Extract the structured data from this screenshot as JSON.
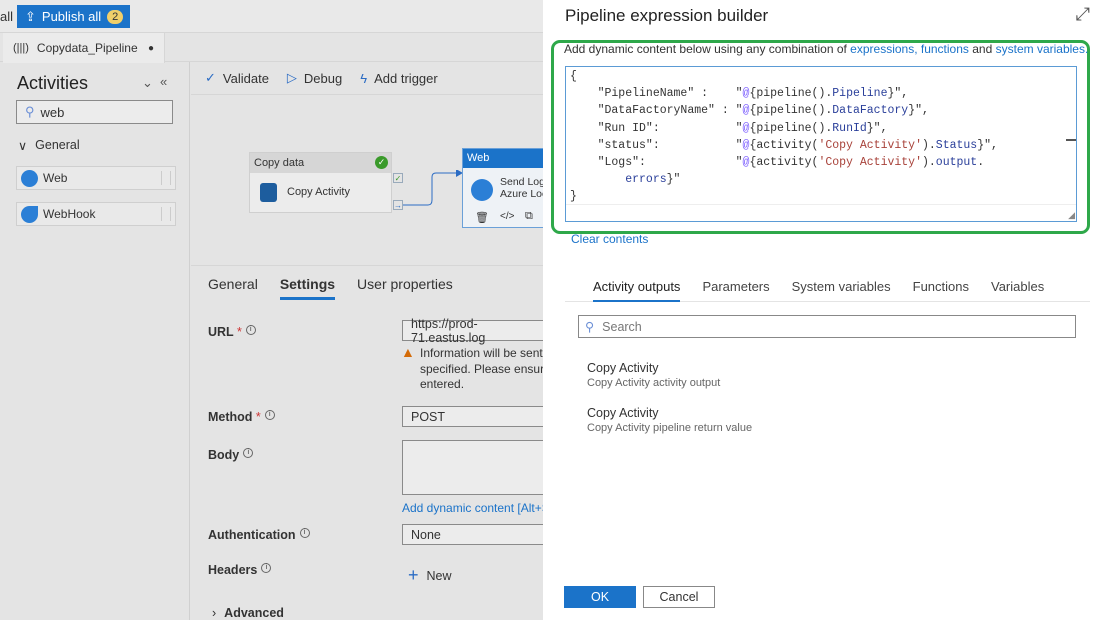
{
  "topbar": {
    "partial_label": "all",
    "publish_label": "Publish all",
    "publish_count": "2"
  },
  "pipeline_tab": {
    "name": "Copydata_Pipeline",
    "unsaved_dot": "●"
  },
  "activities": {
    "title": "Activities",
    "search_value": "web",
    "group": "General",
    "items": [
      {
        "label": "Web"
      },
      {
        "label": "WebHook"
      }
    ]
  },
  "toolbar": {
    "validate": "Validate",
    "debug": "Debug",
    "add_trigger": "Add trigger"
  },
  "canvas": {
    "copy_node": {
      "header": "Copy data",
      "name": "Copy Activity"
    },
    "web_node": {
      "header": "Web",
      "name_line1": "Send Log",
      "name_line2": "Azure Loc"
    }
  },
  "settings": {
    "tabs": [
      "General",
      "Settings",
      "User properties"
    ],
    "url_label": "URL",
    "url_value": "https://prod-71.eastus.log",
    "warning": [
      "Information will be sent",
      "specified. Please ensure",
      "entered."
    ],
    "method_label": "Method",
    "method_value": "POST",
    "body_label": "Body",
    "dynamic_link": "Add dynamic content [Alt+Sh",
    "auth_label": "Authentication",
    "auth_value": "None",
    "headers_label": "Headers",
    "new_label": "New",
    "advanced_label": "Advanced",
    "required": "*"
  },
  "builder": {
    "title": "Pipeline expression builder",
    "desc_prefix": "Add dynamic content below using any combination of ",
    "desc_link1": "expressions, functions",
    "desc_mid": " and ",
    "desc_link2": "system variables.",
    "code_lines": [
      [
        [
          "p",
          "{"
        ]
      ],
      [
        [
          "p",
          "    \"PipelineName\" :    \""
        ],
        [
          "at",
          "@"
        ],
        [
          "p",
          "{pipeline()."
        ],
        [
          "prop",
          "Pipeline"
        ],
        [
          "p",
          "}\","
        ]
      ],
      [
        [
          "p",
          "    \"DataFactoryName\" : \""
        ],
        [
          "at",
          "@"
        ],
        [
          "p",
          "{pipeline()."
        ],
        [
          "prop",
          "DataFactory"
        ],
        [
          "p",
          "}\","
        ]
      ],
      [
        [
          "p",
          "    \"Run ID\":           \""
        ],
        [
          "at",
          "@"
        ],
        [
          "p",
          "{pipeline()."
        ],
        [
          "prop",
          "RunId"
        ],
        [
          "p",
          "}\","
        ]
      ],
      [
        [
          "p",
          "    \"status\":           \""
        ],
        [
          "at",
          "@"
        ],
        [
          "p",
          "{activity("
        ],
        [
          "str",
          "'Copy Activity'"
        ],
        [
          "p",
          ")."
        ],
        [
          "prop",
          "Status"
        ],
        [
          "p",
          "}\","
        ]
      ],
      [
        [
          "p",
          "    \"Logs\":             \""
        ],
        [
          "at",
          "@"
        ],
        [
          "p",
          "{activity("
        ],
        [
          "str",
          "'Copy Activity'"
        ],
        [
          "p",
          ")."
        ],
        [
          "prop",
          "output"
        ],
        [
          "p",
          "."
        ]
      ],
      [
        [
          "p",
          "        "
        ],
        [
          "prop",
          "errors"
        ],
        [
          "p",
          "}\""
        ]
      ],
      [
        [
          "p",
          "}"
        ]
      ]
    ],
    "clear": "Clear contents",
    "tabs": [
      "Activity outputs",
      "Parameters",
      "System variables",
      "Functions",
      "Variables"
    ],
    "search_placeholder": "Search",
    "outputs": [
      {
        "title": "Copy Activity",
        "sub": "Copy Activity activity output"
      },
      {
        "title": "Copy Activity",
        "sub": "Copy Activity pipeline return value"
      }
    ],
    "ok": "OK",
    "cancel": "Cancel"
  }
}
